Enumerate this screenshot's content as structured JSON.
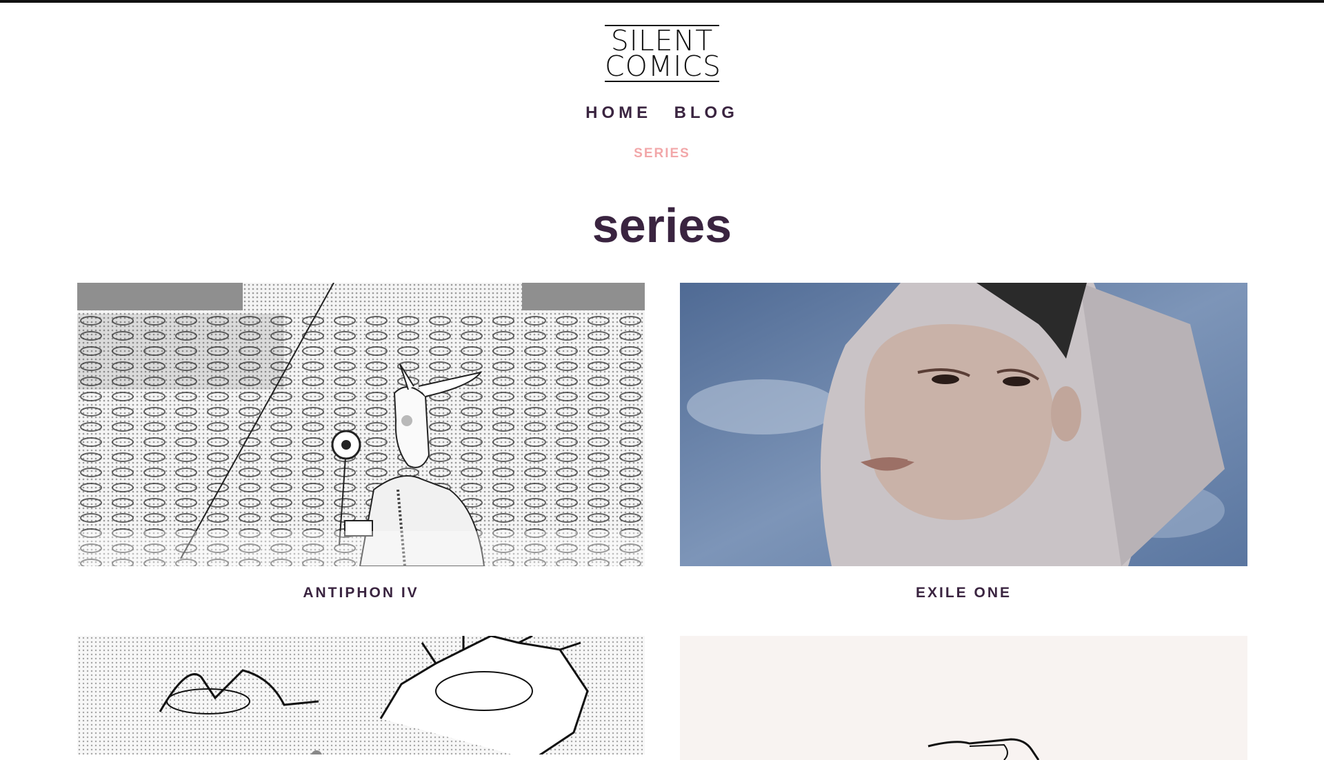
{
  "logo": {
    "line1": "SILENT",
    "line2": "COMICS"
  },
  "nav": {
    "home": "HOME",
    "blog": "BLOG"
  },
  "subnav": {
    "series": "SERIES"
  },
  "page": {
    "title": "series"
  },
  "series": [
    {
      "title": "ANTIPHON IV",
      "image": "donkey-head-figure-in-flower-field"
    },
    {
      "title": "EXILE ONE",
      "image": "woman-with-white-veil-portrait"
    },
    {
      "title": "",
      "image": "skeleton-and-creature-sketch"
    },
    {
      "title": "",
      "image": "pointing-hand-sketch"
    }
  ]
}
